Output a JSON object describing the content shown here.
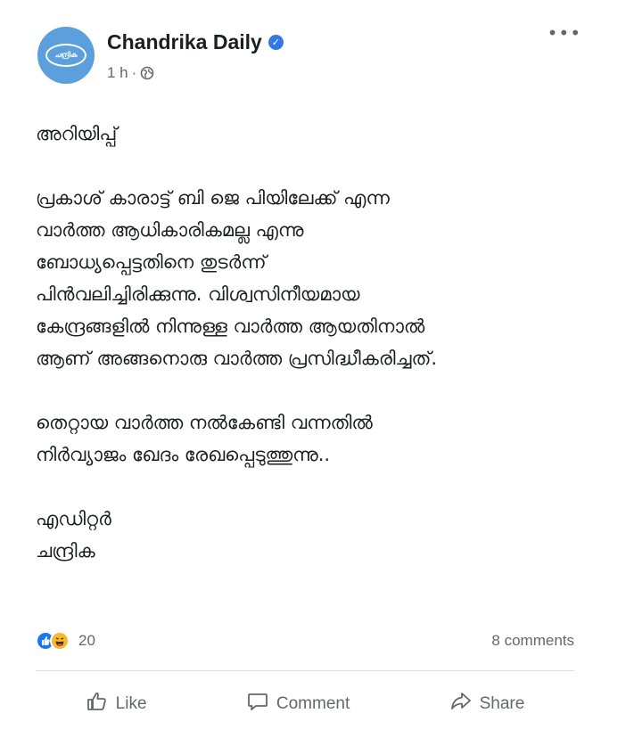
{
  "post": {
    "page_name": "Chandrika Daily",
    "avatar_text": "ചന്ദ്രിക",
    "time": "1 h",
    "separator": "·",
    "more_label": "•••",
    "paragraphs": [
      [
        "അറിയിപ്പ്"
      ],
      [
        "പ്രകാശ് കാരാട്ട് ബി ജെ പിയിലേക്ക് എന്ന",
        "വാർത്ത ആധികാരികമല്ല എന്നു",
        "ബോധ്യപ്പെട്ടതിനെ തുടർന്ന്",
        "പിൻവലിച്ചിരിക്കുന്നു.  വിശ്വസിനീയമായ",
        "കേന്ദ്രങ്ങളിൽ നിന്നുള്ള വാർത്ത ആയതിനാൽ",
        "ആണ് അങ്ങനൊരു വാർത്ത പ്രസിദ്ധീകരിച്ചത്."
      ],
      [
        "തെറ്റായ വാർത്ത നൽകേണ്ടി വന്നതിൽ",
        "നിർവ്യാജം ഖേദം രേഖപ്പെടുത്തുന്നു.."
      ],
      [
        "എഡിറ്റർ",
        "ചന്ദ്രിക"
      ]
    ],
    "reaction_count": "20",
    "comments_count": "8 comments",
    "actions": {
      "like": "Like",
      "comment": "Comment",
      "share": "Share"
    }
  },
  "colors": {
    "accent": "#1877f2",
    "avatar_bg": "#5b9fdc",
    "meta_text": "#65676b"
  }
}
